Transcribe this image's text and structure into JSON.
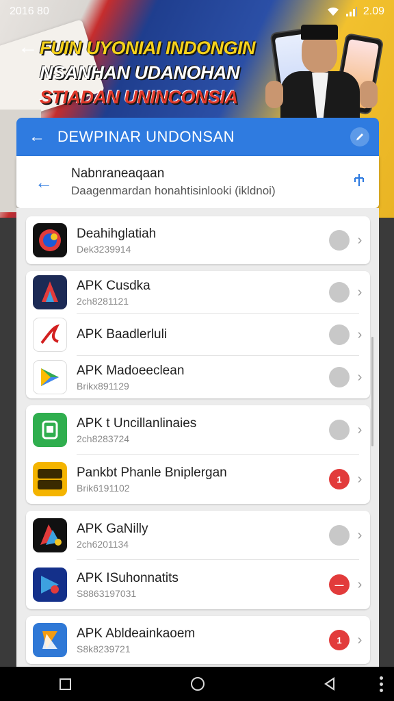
{
  "status_bar": {
    "time": "2016 80",
    "battery": "2.09"
  },
  "banner": {
    "line1": "FUIN UYONIAI INDONGIN",
    "line2": "NSANHAN UDANOHAN",
    "line3": "STIADAN UNINCONSIA"
  },
  "dialog": {
    "title": "DEWPINAR UNDONSAN",
    "subtitle": "Nabnraneaqaan",
    "description": "Daagenmardan honahtisinlooki (ikldnoi)"
  },
  "apps": [
    {
      "name": "Deahihglatiah",
      "sub": "Dek3239914",
      "badge": "",
      "alert": false
    },
    {
      "name": "APK Cusdka",
      "sub": "2ch8281121",
      "badge": "",
      "alert": false
    },
    {
      "name": "APK Baadlerluli",
      "sub": "",
      "badge": "",
      "alert": false
    },
    {
      "name": "APK Madoeeclean",
      "sub": "Brikx891129",
      "badge": "",
      "alert": false
    },
    {
      "name": "APK t Uncillanlinaies",
      "sub": "2ch8283724",
      "badge": "",
      "alert": false
    },
    {
      "name": "Pankbt Phanle Bniplergan",
      "sub": "Brik6191102",
      "badge": "1",
      "alert": true
    },
    {
      "name": "APK GaNilly",
      "sub": "2ch6201134",
      "badge": "",
      "alert": false
    },
    {
      "name": "APK ISuhonnatits",
      "sub": "S8863197031",
      "badge": "—",
      "alert": true
    },
    {
      "name": "APK Abldeainkaoem",
      "sub": "S8k8239721",
      "badge": "1",
      "alert": true
    }
  ],
  "colors": {
    "primary": "#2f7be0",
    "alert": "#e23b3b",
    "muted": "#c8c8c8"
  }
}
